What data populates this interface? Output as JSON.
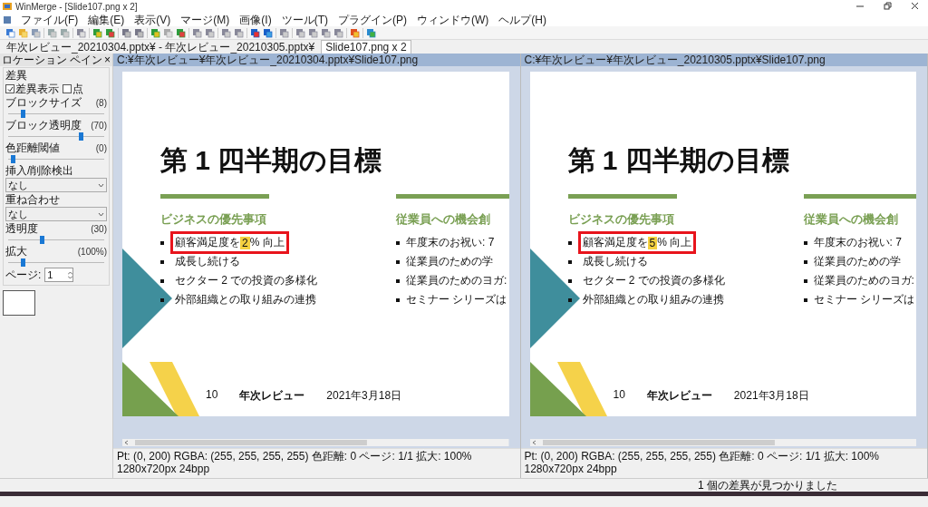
{
  "window": {
    "title": "WinMerge - [Slide107.png x 2]"
  },
  "menu": [
    "ファイル(F)",
    "編集(E)",
    "表示(V)",
    "マージ(M)",
    "画像(I)",
    "ツール(T)",
    "プラグイン(P)",
    "ウィンドウ(W)",
    "ヘルプ(H)"
  ],
  "tabs": [
    {
      "label": "年次レビュー_20210304.pptx¥ - 年次レビュー_20210305.pptx¥",
      "selected": false
    },
    {
      "label": "Slide107.png x 2",
      "selected": true
    }
  ],
  "location_pane": {
    "title": "ロケーション ペイン",
    "close": "×",
    "group": "差異",
    "checkboxes": [
      {
        "label": "差異表示",
        "checked": true
      },
      {
        "label": "点",
        "checked": false
      }
    ],
    "controls": [
      {
        "kind": "slider",
        "label": "ブロックサイズ",
        "reading": "(8)",
        "level": 0.15
      },
      {
        "kind": "slider",
        "label": "ブロック透明度",
        "reading": "(70)",
        "level": 0.75
      },
      {
        "kind": "slider",
        "label": "色距離閾値",
        "reading": "(0)",
        "level": 0.05
      },
      {
        "kind": "dropdown",
        "label": "挿入/削除検出",
        "value": "なし"
      },
      {
        "kind": "group",
        "label": "重ね合わせ"
      },
      {
        "kind": "dropdown",
        "value": "なし"
      },
      {
        "kind": "slider",
        "label": "透明度",
        "reading": "(30)",
        "level": 0.35
      },
      {
        "kind": "slider",
        "label": "拡大",
        "reading": "(100%)",
        "level": 0.15
      },
      {
        "kind": "spinner",
        "label": "ページ:",
        "value": "1"
      }
    ]
  },
  "panes": [
    {
      "path": "C:¥年次レビュー¥年次レビュー_20210304.pptx¥Slide107.png",
      "slide": {
        "title": "第 1 四半期の目標",
        "heading": "ビジネスの優先事項",
        "bullets": [
          {
            "text": "顧客満足度を ",
            "diff": "2",
            "rest": "% 向上",
            "marked": true
          },
          {
            "text": "成長し続ける",
            "marked": false
          },
          {
            "text": "セクター 2 での投資の多様化",
            "marked": false
          },
          {
            "text": "外部組織との取り組みの連携",
            "marked": false
          }
        ],
        "heading2": "従業員への機会創",
        "bullets2": [
          "年度末のお祝い: 7",
          "従業員のための学",
          "従業員のためのヨガ:",
          "セミナー シリーズは"
        ],
        "footer": {
          "page": "10",
          "name": "年次レビュー",
          "date": "2021年3月18日"
        }
      },
      "status": "Pt: (0, 200)  RGBA: (255, 255, 255, 255)  色距離: 0  ページ: 1/1  拡大: 100%  1280x720px  24bpp"
    },
    {
      "path": "C:¥年次レビュー¥年次レビュー_20210305.pptx¥Slide107.png",
      "slide": {
        "title": "第 1 四半期の目標",
        "heading": "ビジネスの優先事項",
        "bullets": [
          {
            "text": "顧客満足度を ",
            "diff": "5",
            "rest": "% 向上",
            "marked": true
          },
          {
            "text": "成長し続ける",
            "marked": false
          },
          {
            "text": "セクター 2 での投資の多様化",
            "marked": false
          },
          {
            "text": "外部組織との取り組みの連携",
            "marked": false
          }
        ],
        "heading2": "従業員への機会創",
        "bullets2": [
          "年度末のお祝い: 7",
          "従業員のための学",
          "従業員のためのヨガ:",
          "セミナー シリーズは"
        ],
        "footer": {
          "page": "10",
          "name": "年次レビュー",
          "date": "2021年3月18日"
        }
      },
      "status": "Pt: (0, 200)  RGBA: (255, 255, 255, 255)  色距離: 0  ページ: 1/1  拡大: 100%  1280x720px  24bpp"
    }
  ],
  "status_message": "1 個の差異が見つかりました"
}
